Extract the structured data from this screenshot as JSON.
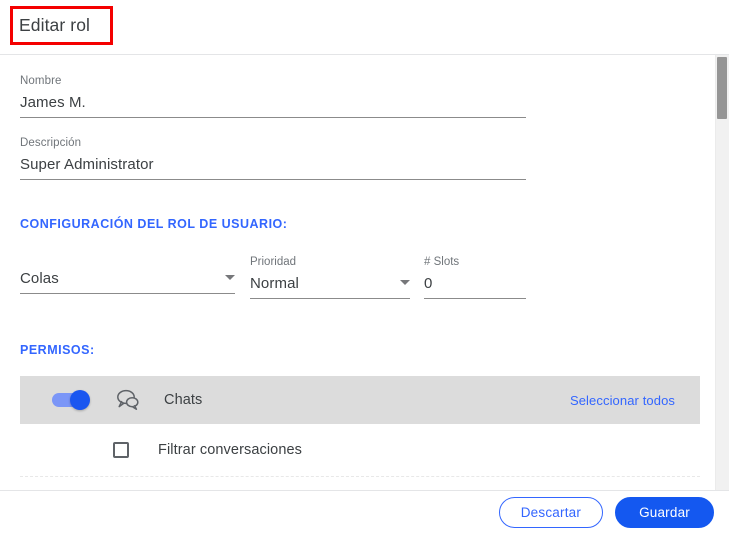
{
  "header": {
    "title": "Editar rol",
    "annotation_color": "#f40000"
  },
  "form": {
    "nombre": {
      "label": "Nombre",
      "value": "James M."
    },
    "descripcion": {
      "label": "Descripción",
      "value": "Super Administrator"
    }
  },
  "config_section": {
    "heading": "CONFIGURACIÓN DEL ROL DE USUARIO:",
    "colas": {
      "label": "",
      "value": "Colas",
      "icon": "chevron-down-icon"
    },
    "prioridad": {
      "label": "Prioridad",
      "value": "Normal",
      "icon": "chevron-down-icon"
    },
    "slots": {
      "label": "# Slots",
      "value": "0"
    }
  },
  "permissions_section": {
    "heading": "PERMISOS:",
    "groups": [
      {
        "name": "Chats",
        "icon": "chat-bubbles-icon",
        "toggle_on": true,
        "select_all_label": "Seleccionar todos",
        "items": [
          {
            "label": "Filtrar conversaciones",
            "checked": false
          }
        ]
      }
    ]
  },
  "footer": {
    "discard_label": "Descartar",
    "save_label": "Guardar"
  },
  "colors": {
    "accent_blue": "#3366ff",
    "primary_blue": "#1458f0",
    "group_row_gray": "#dcdcdc",
    "annotation_red": "#f40000"
  }
}
